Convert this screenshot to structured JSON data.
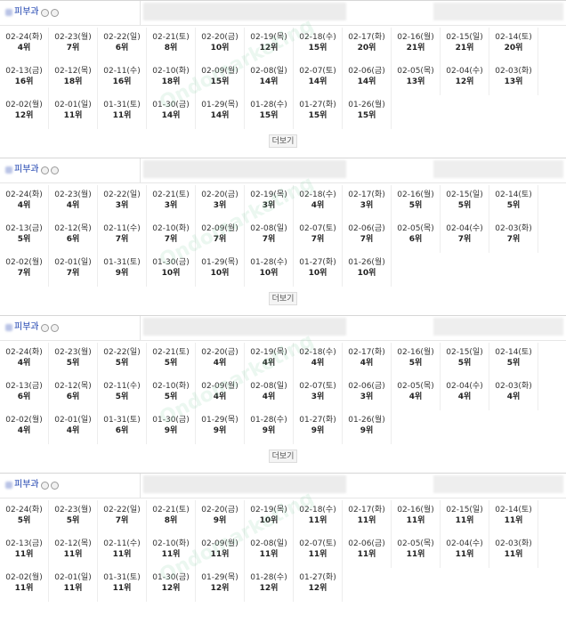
{
  "watermark": "Ondomarketing",
  "more_label": "더보기",
  "sections": [
    {
      "name": "피부과",
      "cells": [
        {
          "d": "02-24(화)",
          "r": "4위"
        },
        {
          "d": "02-23(월)",
          "r": "7위"
        },
        {
          "d": "02-22(일)",
          "r": "6위"
        },
        {
          "d": "02-21(토)",
          "r": "8위"
        },
        {
          "d": "02-20(금)",
          "r": "10위"
        },
        {
          "d": "02-19(목)",
          "r": "12위"
        },
        {
          "d": "02-18(수)",
          "r": "15위"
        },
        {
          "d": "02-17(화)",
          "r": "20위"
        },
        {
          "d": "02-16(월)",
          "r": "21위"
        },
        {
          "d": "02-15(일)",
          "r": "21위"
        },
        {
          "d": "02-14(토)",
          "r": "20위"
        },
        {
          "d": "02-13(금)",
          "r": "16위"
        },
        {
          "d": "02-12(목)",
          "r": "18위"
        },
        {
          "d": "02-11(수)",
          "r": "16위"
        },
        {
          "d": "02-10(화)",
          "r": "18위"
        },
        {
          "d": "02-09(월)",
          "r": "15위"
        },
        {
          "d": "02-08(일)",
          "r": "14위"
        },
        {
          "d": "02-07(토)",
          "r": "14위"
        },
        {
          "d": "02-06(금)",
          "r": "14위"
        },
        {
          "d": "02-05(목)",
          "r": "13위"
        },
        {
          "d": "02-04(수)",
          "r": "12위"
        },
        {
          "d": "02-03(화)",
          "r": "13위"
        },
        {
          "d": "02-02(월)",
          "r": "12위"
        },
        {
          "d": "02-01(일)",
          "r": "11위"
        },
        {
          "d": "01-31(토)",
          "r": "11위"
        },
        {
          "d": "01-30(금)",
          "r": "14위"
        },
        {
          "d": "01-29(목)",
          "r": "14위"
        },
        {
          "d": "01-28(수)",
          "r": "15위"
        },
        {
          "d": "01-27(화)",
          "r": "15위"
        },
        {
          "d": "01-26(월)",
          "r": "15위"
        }
      ]
    },
    {
      "name": "피부과",
      "cells": [
        {
          "d": "02-24(화)",
          "r": "4위"
        },
        {
          "d": "02-23(월)",
          "r": "4위"
        },
        {
          "d": "02-22(일)",
          "r": "3위"
        },
        {
          "d": "02-21(토)",
          "r": "3위"
        },
        {
          "d": "02-20(금)",
          "r": "3위"
        },
        {
          "d": "02-19(목)",
          "r": "3위"
        },
        {
          "d": "02-18(수)",
          "r": "4위"
        },
        {
          "d": "02-17(화)",
          "r": "3위"
        },
        {
          "d": "02-16(월)",
          "r": "5위"
        },
        {
          "d": "02-15(일)",
          "r": "5위"
        },
        {
          "d": "02-14(토)",
          "r": "5위"
        },
        {
          "d": "02-13(금)",
          "r": "5위"
        },
        {
          "d": "02-12(목)",
          "r": "6위"
        },
        {
          "d": "02-11(수)",
          "r": "7위"
        },
        {
          "d": "02-10(화)",
          "r": "7위"
        },
        {
          "d": "02-09(월)",
          "r": "7위"
        },
        {
          "d": "02-08(일)",
          "r": "7위"
        },
        {
          "d": "02-07(토)",
          "r": "7위"
        },
        {
          "d": "02-06(금)",
          "r": "7위"
        },
        {
          "d": "02-05(목)",
          "r": "6위"
        },
        {
          "d": "02-04(수)",
          "r": "7위"
        },
        {
          "d": "02-03(화)",
          "r": "7위"
        },
        {
          "d": "02-02(월)",
          "r": "7위"
        },
        {
          "d": "02-01(일)",
          "r": "7위"
        },
        {
          "d": "01-31(토)",
          "r": "9위"
        },
        {
          "d": "01-30(금)",
          "r": "10위"
        },
        {
          "d": "01-29(목)",
          "r": "10위"
        },
        {
          "d": "01-28(수)",
          "r": "10위"
        },
        {
          "d": "01-27(화)",
          "r": "10위"
        },
        {
          "d": "01-26(월)",
          "r": "10위"
        }
      ]
    },
    {
      "name": "피부과",
      "cells": [
        {
          "d": "02-24(화)",
          "r": "4위"
        },
        {
          "d": "02-23(월)",
          "r": "5위"
        },
        {
          "d": "02-22(일)",
          "r": "5위"
        },
        {
          "d": "02-21(토)",
          "r": "5위"
        },
        {
          "d": "02-20(금)",
          "r": "4위"
        },
        {
          "d": "02-19(목)",
          "r": "4위"
        },
        {
          "d": "02-18(수)",
          "r": "4위"
        },
        {
          "d": "02-17(화)",
          "r": "4위"
        },
        {
          "d": "02-16(월)",
          "r": "5위"
        },
        {
          "d": "02-15(일)",
          "r": "5위"
        },
        {
          "d": "02-14(토)",
          "r": "5위"
        },
        {
          "d": "02-13(금)",
          "r": "6위"
        },
        {
          "d": "02-12(목)",
          "r": "6위"
        },
        {
          "d": "02-11(수)",
          "r": "5위"
        },
        {
          "d": "02-10(화)",
          "r": "5위"
        },
        {
          "d": "02-09(월)",
          "r": "4위"
        },
        {
          "d": "02-08(일)",
          "r": "4위"
        },
        {
          "d": "02-07(토)",
          "r": "3위"
        },
        {
          "d": "02-06(금)",
          "r": "3위"
        },
        {
          "d": "02-05(목)",
          "r": "4위"
        },
        {
          "d": "02-04(수)",
          "r": "4위"
        },
        {
          "d": "02-03(화)",
          "r": "4위"
        },
        {
          "d": "02-02(월)",
          "r": "4위"
        },
        {
          "d": "02-01(일)",
          "r": "4위"
        },
        {
          "d": "01-31(토)",
          "r": "6위"
        },
        {
          "d": "01-30(금)",
          "r": "9위"
        },
        {
          "d": "01-29(목)",
          "r": "9위"
        },
        {
          "d": "01-28(수)",
          "r": "9위"
        },
        {
          "d": "01-27(화)",
          "r": "9위"
        },
        {
          "d": "01-26(월)",
          "r": "9위"
        }
      ]
    },
    {
      "name": "피부과",
      "cells": [
        {
          "d": "02-24(화)",
          "r": "5위"
        },
        {
          "d": "02-23(월)",
          "r": "5위"
        },
        {
          "d": "02-22(일)",
          "r": "7위"
        },
        {
          "d": "02-21(토)",
          "r": "8위"
        },
        {
          "d": "02-20(금)",
          "r": "9위"
        },
        {
          "d": "02-19(목)",
          "r": "10위"
        },
        {
          "d": "02-18(수)",
          "r": "11위"
        },
        {
          "d": "02-17(화)",
          "r": "11위"
        },
        {
          "d": "02-16(월)",
          "r": "11위"
        },
        {
          "d": "02-15(일)",
          "r": "11위"
        },
        {
          "d": "02-14(토)",
          "r": "11위"
        },
        {
          "d": "02-13(금)",
          "r": "11위"
        },
        {
          "d": "02-12(목)",
          "r": "11위"
        },
        {
          "d": "02-11(수)",
          "r": "11위"
        },
        {
          "d": "02-10(화)",
          "r": "11위"
        },
        {
          "d": "02-09(월)",
          "r": "11위"
        },
        {
          "d": "02-08(일)",
          "r": "11위"
        },
        {
          "d": "02-07(토)",
          "r": "11위"
        },
        {
          "d": "02-06(금)",
          "r": "11위"
        },
        {
          "d": "02-05(목)",
          "r": "11위"
        },
        {
          "d": "02-04(수)",
          "r": "11위"
        },
        {
          "d": "02-03(화)",
          "r": "11위"
        },
        {
          "d": "02-02(월)",
          "r": "11위"
        },
        {
          "d": "02-01(일)",
          "r": "11위"
        },
        {
          "d": "01-31(토)",
          "r": "11위"
        },
        {
          "d": "01-30(금)",
          "r": "12위"
        },
        {
          "d": "01-29(목)",
          "r": "12위"
        },
        {
          "d": "01-28(수)",
          "r": "12위"
        },
        {
          "d": "01-27(화)",
          "r": "12위"
        }
      ]
    }
  ]
}
